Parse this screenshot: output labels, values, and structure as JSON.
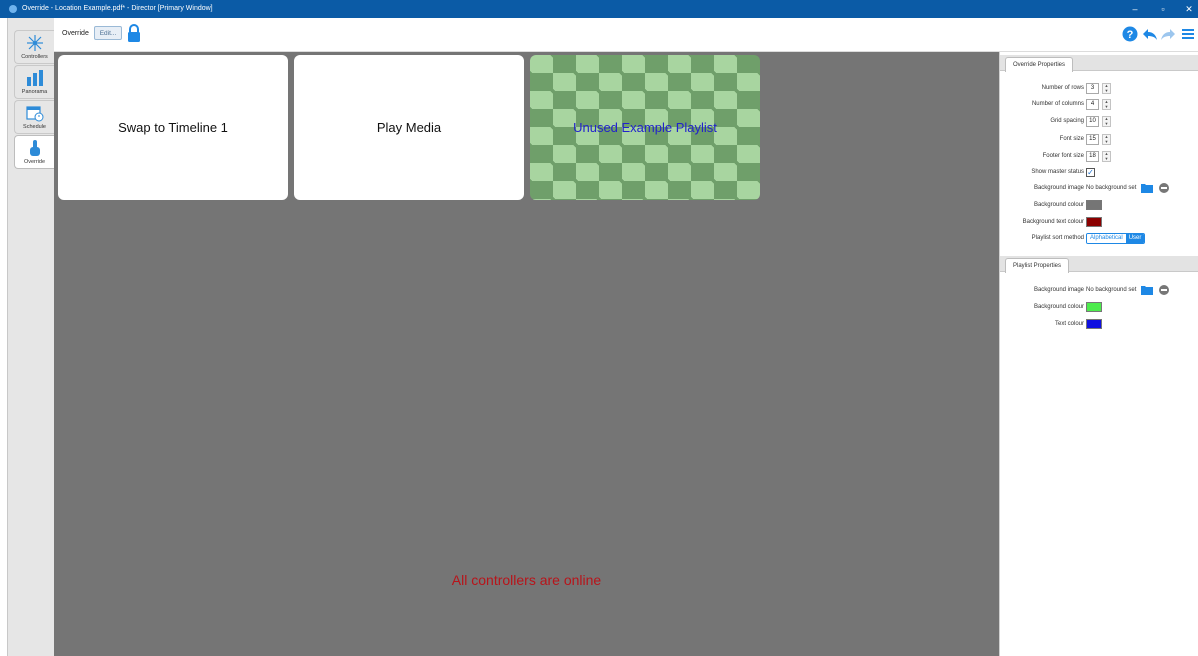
{
  "window": {
    "title": "Override - Location Example.pdf* - Director [Primary Window]",
    "minimize": "–",
    "restore": "▫",
    "close": "✕"
  },
  "sidebar": {
    "items": [
      {
        "label": "Controllers",
        "icon": "controllers-icon"
      },
      {
        "label": "Panorama",
        "icon": "panorama-icon"
      },
      {
        "label": "Schedule",
        "icon": "schedule-icon"
      },
      {
        "label": "Override",
        "icon": "override-icon"
      }
    ]
  },
  "toolbar": {
    "title": "Override",
    "edit_label": "Edit..."
  },
  "tiles": [
    {
      "label": "Swap to Timeline 1"
    },
    {
      "label": "Play Media"
    },
    {
      "label": "Unused Example Playlist"
    }
  ],
  "status": {
    "message": "All controllers are online"
  },
  "override_properties": {
    "tab_label": "Override Properties",
    "rows_label": "Number of rows",
    "rows_value": "3",
    "columns_label": "Number of columns",
    "columns_value": "4",
    "spacing_label": "Grid spacing",
    "spacing_value": "10",
    "font_label": "Font size",
    "font_value": "15",
    "footer_label": "Footer font size",
    "footer_value": "18",
    "master_label": "Show master status",
    "bg_image_label": "Background image",
    "bg_image_value": "No background set",
    "bg_colour_label": "Background colour",
    "bg_text_colour_label": "Background text colour",
    "sort_label": "Playlist sort method",
    "sort_options": [
      "Alphabetical",
      "User"
    ]
  },
  "playlist_properties": {
    "tab_label": "Playlist Properties",
    "bg_image_label": "Background image",
    "bg_image_value": "No background set",
    "bg_colour_label": "Background colour",
    "text_colour_label": "Text colour"
  },
  "colors": {
    "title_bar": "#0b5ba6",
    "canvas_bg": "#757575",
    "accent_blue": "#1e88e5",
    "status_red": "#b8141a",
    "bg_colour_swatch": "#757575",
    "bg_text_colour_swatch": "#8b0000",
    "playlist_bg_swatch": "#4dec4d",
    "playlist_text_swatch": "#1010e0",
    "checker_light": "#a8d5a0",
    "checker_dark": "#6f9f6a"
  }
}
